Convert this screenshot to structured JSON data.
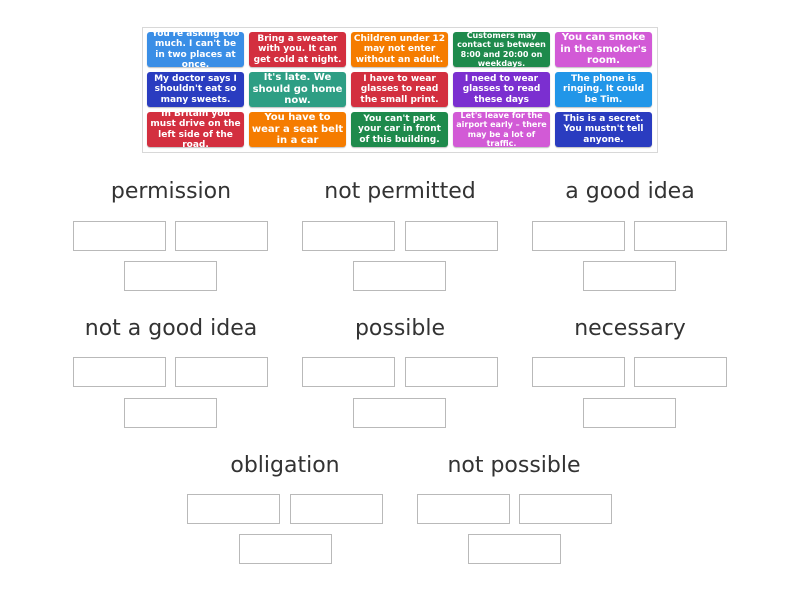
{
  "colors": {
    "blue": "#3a8ee6",
    "red": "#d32f3f",
    "orange": "#f57c00",
    "green": "#1e8a4c",
    "pink": "#d25ad6",
    "navy": "#2a3cc0",
    "teal": "#2e9e84",
    "purple": "#7b2fd0",
    "azure": "#2196e8"
  },
  "cards": [
    {
      "text": "You're asking too much. I can't be in two places at once.",
      "color": "blue"
    },
    {
      "text": "Bring a sweater with you. It can get cold at night.",
      "color": "red"
    },
    {
      "text": "Children under 12 may not enter without an adult.",
      "color": "orange"
    },
    {
      "text": "Customers may contact us between 8:00 and 20:00 on weekdays.",
      "color": "green"
    },
    {
      "text": "You can smoke in the smoker's room.",
      "color": "pink"
    },
    {
      "text": "My doctor says I shouldn't eat so many sweets.",
      "color": "navy"
    },
    {
      "text": "It's late. We should go home now.",
      "color": "teal"
    },
    {
      "text": "I have to wear glasses to read the small print.",
      "color": "red"
    },
    {
      "text": "I need to wear glasses to read these days",
      "color": "purple"
    },
    {
      "text": "The phone is ringing. It could be Tim.",
      "color": "azure"
    },
    {
      "text": "In Britain you must drive on the left side of the road.",
      "color": "red"
    },
    {
      "text": "You have to wear a seat belt in a car",
      "color": "orange"
    },
    {
      "text": "You can't park your car in front of this building.",
      "color": "green"
    },
    {
      "text": "Let's leave for the airport early – there may be a lot of traffic.",
      "color": "pink"
    },
    {
      "text": "This is a secret. You mustn't tell anyone.",
      "color": "navy"
    }
  ],
  "categories": [
    {
      "title": "permission"
    },
    {
      "title": "not permitted"
    },
    {
      "title": "a good idea"
    },
    {
      "title": "not a good idea"
    },
    {
      "title": "possible"
    },
    {
      "title": "necessary"
    },
    {
      "title": "obligation"
    },
    {
      "title": "not possible"
    }
  ]
}
